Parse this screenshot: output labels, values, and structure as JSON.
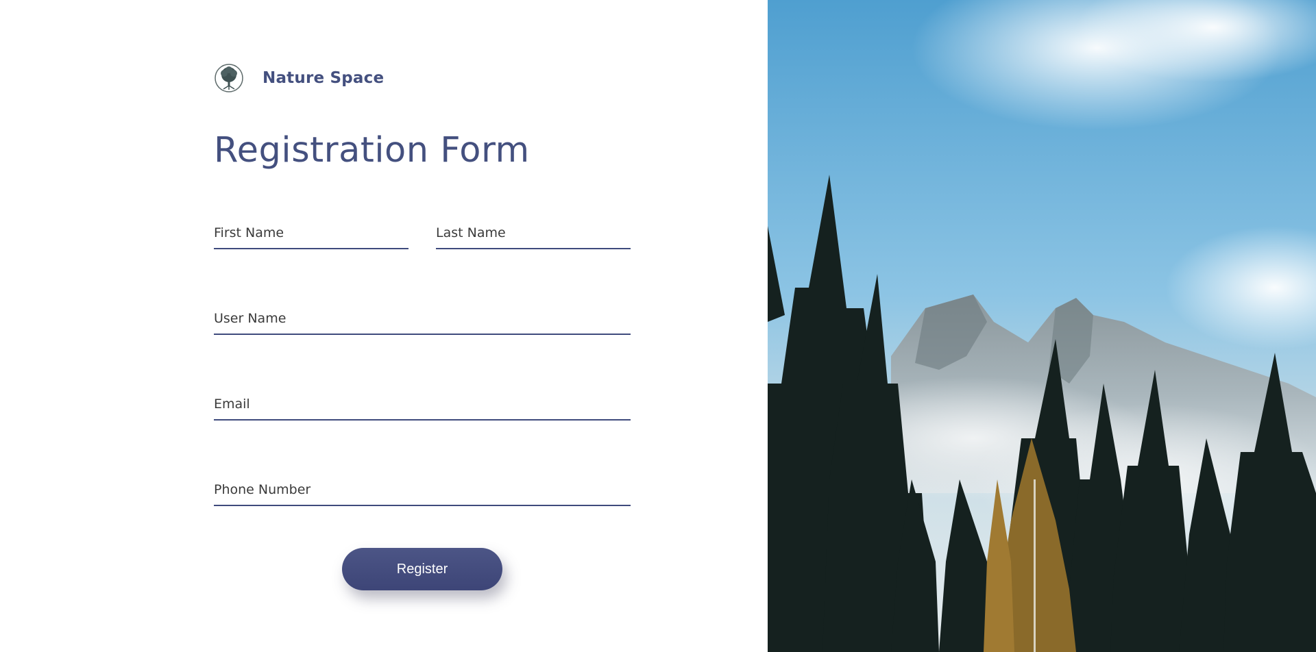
{
  "brand": {
    "name": "Nature Space",
    "logo_icon": "tree-of-life-icon"
  },
  "form": {
    "title": "Registration Form",
    "fields": {
      "first_name_placeholder": "First Name",
      "last_name_placeholder": "Last Name",
      "user_name_placeholder": "User Name",
      "email_placeholder": "Email",
      "phone_placeholder": "Phone Number"
    },
    "register_label": "Register"
  },
  "colors": {
    "accent": "#44507f",
    "button": "#434b7d",
    "underline": "#3e4a7c"
  },
  "hero_image": {
    "icon": "mountain-forest-photo"
  }
}
